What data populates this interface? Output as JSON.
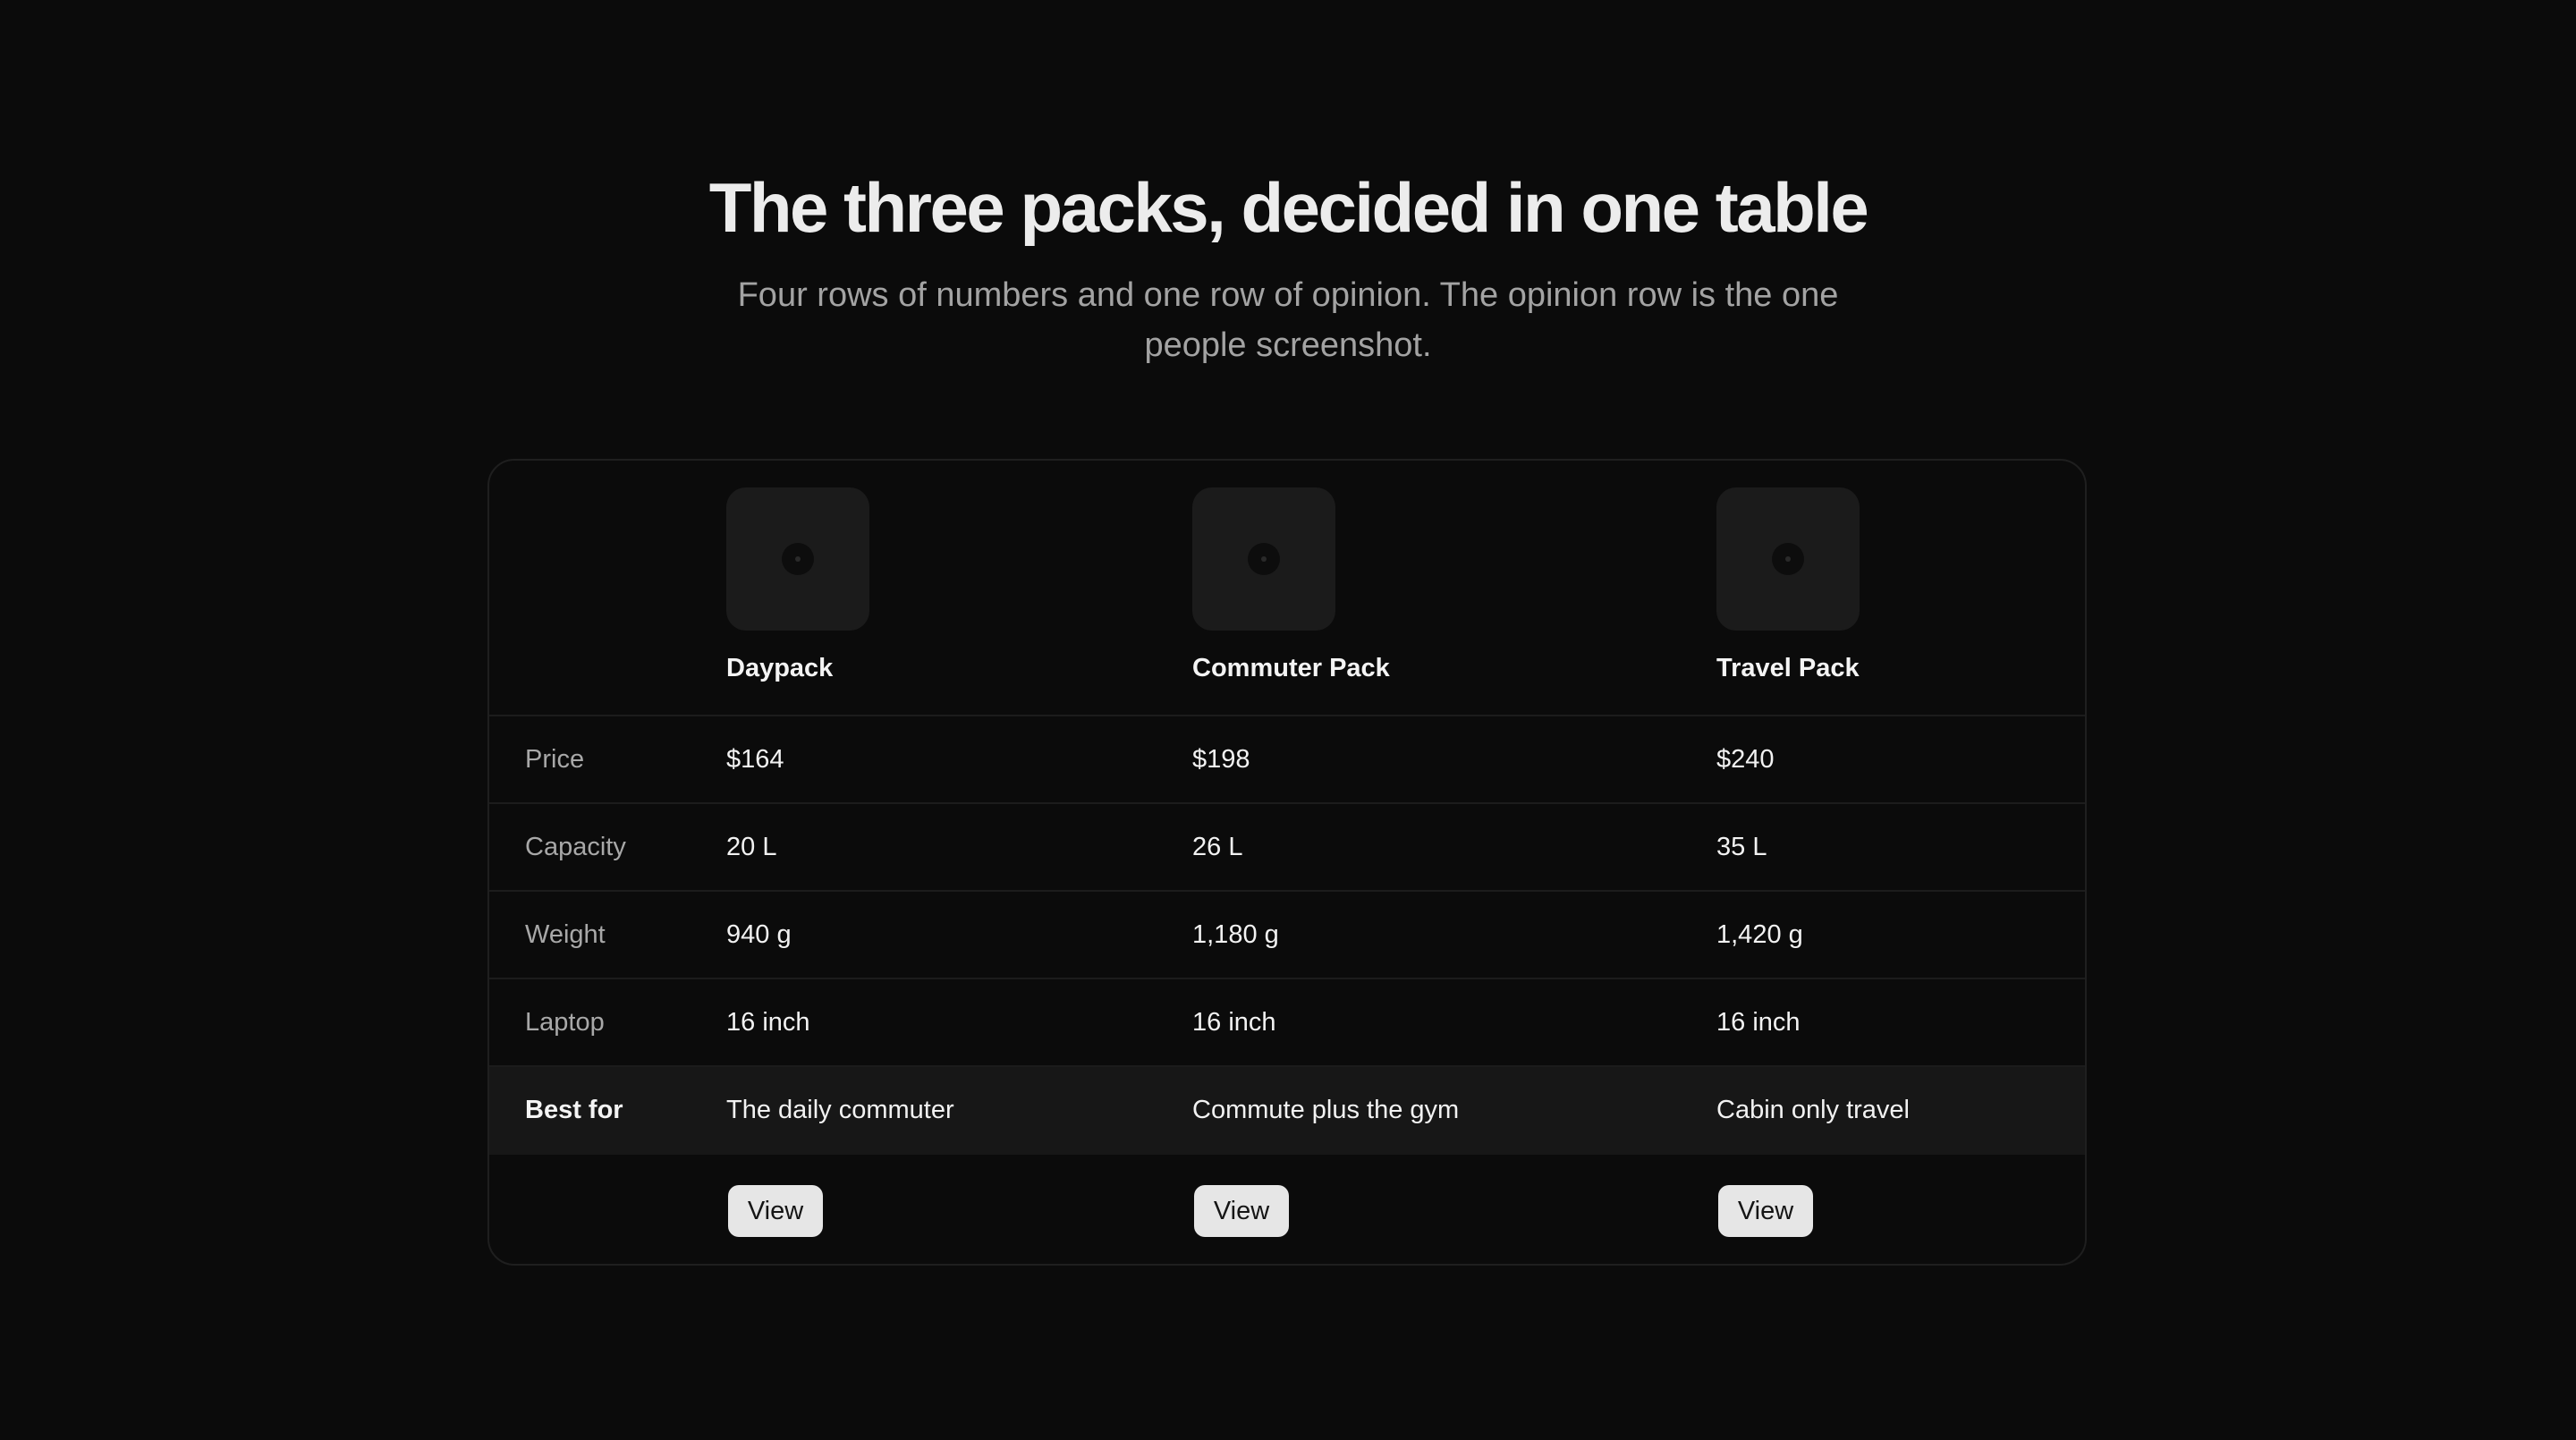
{
  "header": {
    "title": "The three packs, decided in one table",
    "subtitle": "Four rows of numbers and one row of opinion. The opinion row is the one people screenshot."
  },
  "products": [
    {
      "name": "Daypack",
      "icon": "image-placeholder-icon"
    },
    {
      "name": "Commuter Pack",
      "icon": "image-placeholder-icon"
    },
    {
      "name": "Travel Pack",
      "icon": "image-placeholder-icon"
    }
  ],
  "rows": [
    {
      "label": "Price",
      "values": [
        "$164",
        "$198",
        "$240"
      ]
    },
    {
      "label": "Capacity",
      "values": [
        "20 L",
        "26 L",
        "35 L"
      ]
    },
    {
      "label": "Weight",
      "values": [
        "940 g",
        "1,180 g",
        "1,420 g"
      ]
    },
    {
      "label": "Laptop",
      "values": [
        "16 inch",
        "16 inch",
        "16 inch"
      ]
    },
    {
      "label": "Best for",
      "values": [
        "The daily commuter",
        "Commute plus the gym",
        "Cabin only travel"
      ],
      "highlight": true
    }
  ],
  "actions": {
    "view_label": "View"
  },
  "colors": {
    "background": "#0b0b0b",
    "highlight_row": "#171717",
    "button": "#e6e6e6"
  }
}
